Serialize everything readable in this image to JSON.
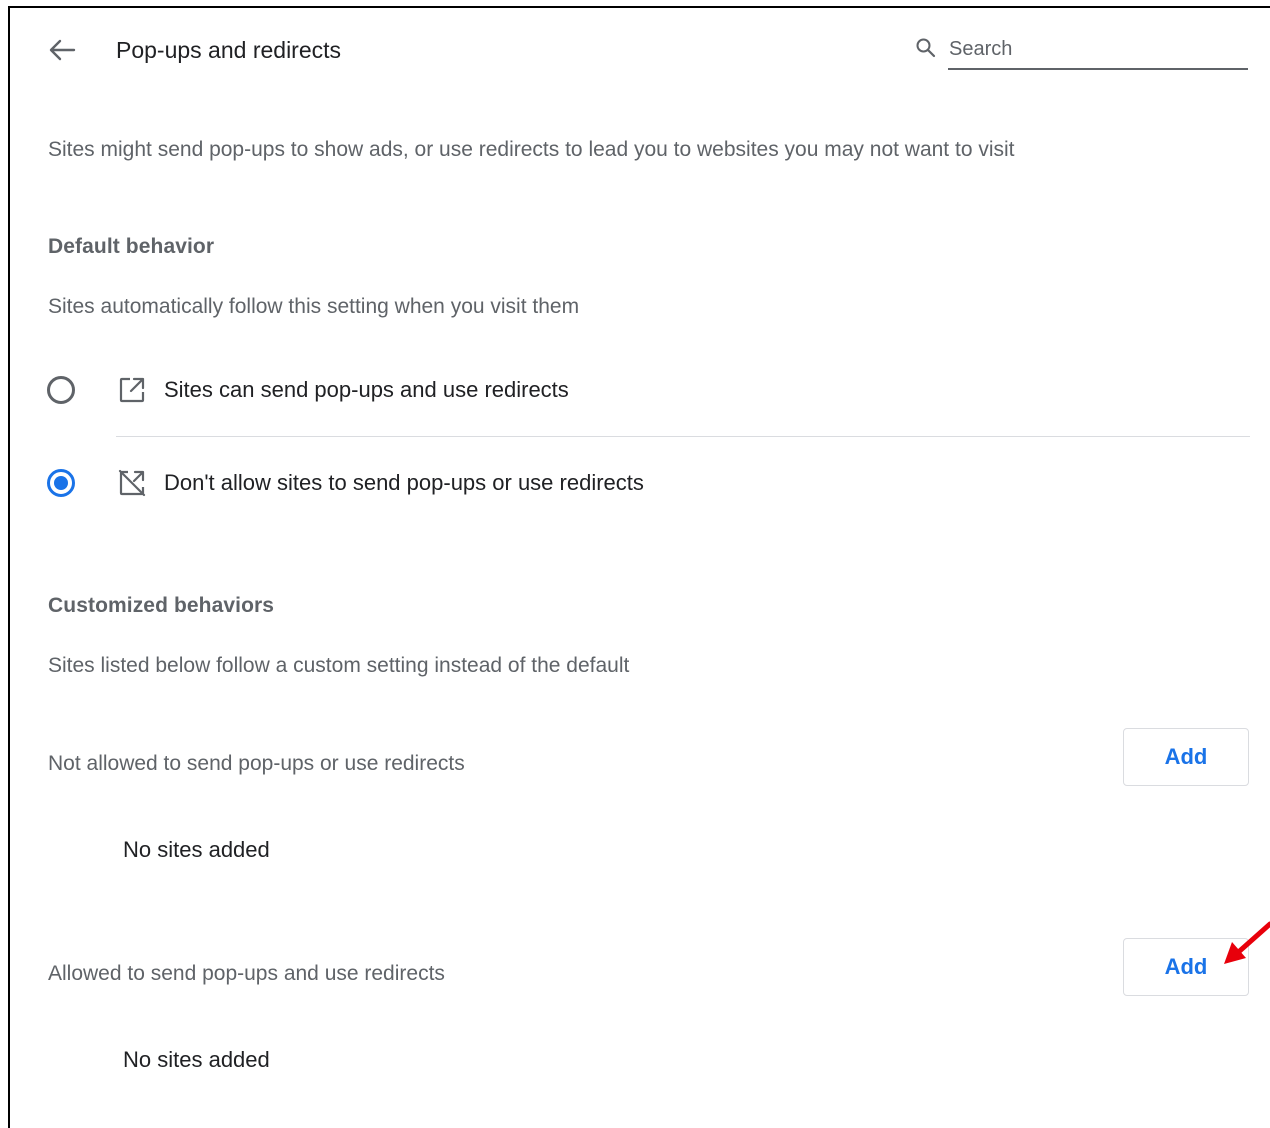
{
  "header": {
    "title": "Pop-ups and redirects",
    "search_placeholder": "Search",
    "search_value": ""
  },
  "description": "Sites might send pop-ups to show ads, or use redirects to lead you to websites you may not want to visit",
  "default_behavior": {
    "heading": "Default behavior",
    "subtitle": "Sites automatically follow this setting when you visit them",
    "options": [
      {
        "label": "Sites can send pop-ups and use redirects",
        "icon": "open-in-new-icon",
        "selected": false
      },
      {
        "label": "Don't allow sites to send pop-ups or use redirects",
        "icon": "blocked-popup-icon",
        "selected": true
      }
    ]
  },
  "customized_behaviors": {
    "heading": "Customized behaviors",
    "subtitle": "Sites listed below follow a custom setting instead of the default",
    "lists": [
      {
        "label": "Not allowed to send pop-ups or use redirects",
        "add_label": "Add",
        "empty_text": "No sites added"
      },
      {
        "label": "Allowed to send pop-ups and use redirects",
        "add_label": "Add",
        "empty_text": "No sites added"
      }
    ]
  },
  "colors": {
    "accent": "#1a73e8",
    "annotation_arrow": "#e8000b",
    "text_primary": "#202124",
    "text_secondary": "#5f6368"
  }
}
